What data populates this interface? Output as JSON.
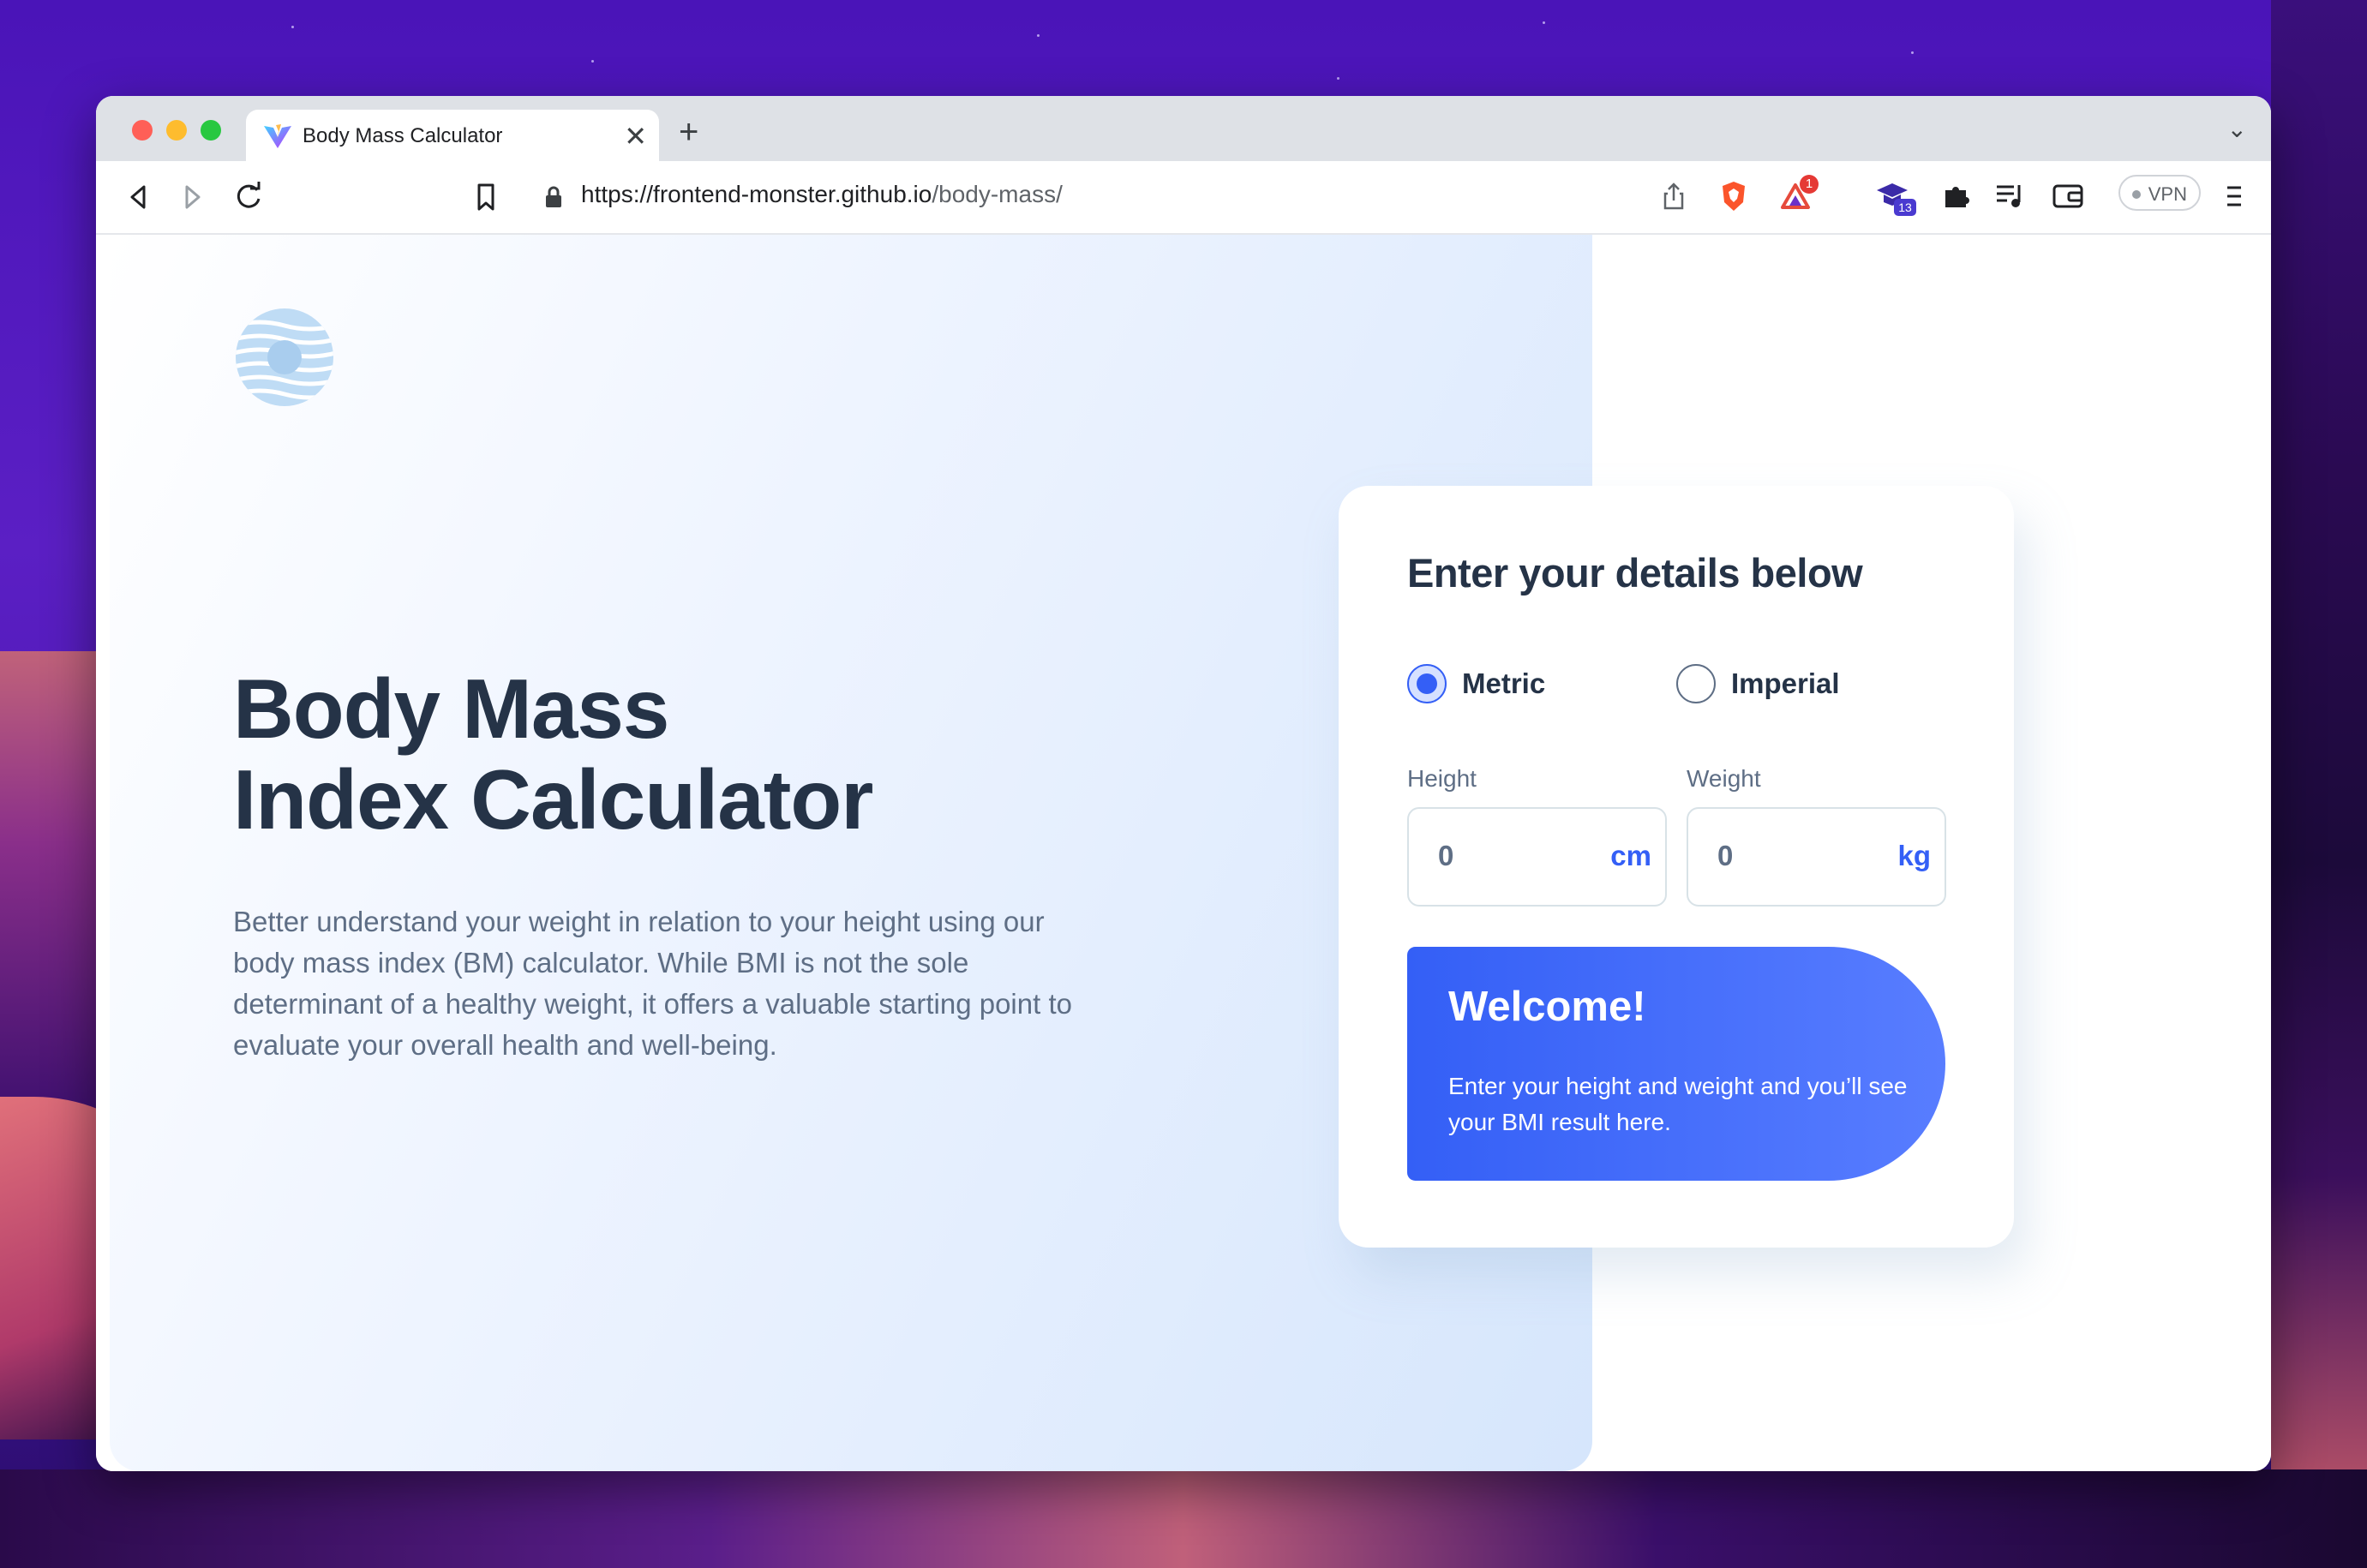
{
  "browser": {
    "tab_title": "Body Mass Calculator",
    "tab_close": "✕",
    "new_tab": "+",
    "tab_menu": "⌄",
    "url_host": "https://frontend-monster.github.io",
    "url_path": "/body-mass/",
    "vpn_label": "VPN",
    "extension_badge": "13",
    "rewards_badge": "1"
  },
  "page": {
    "headline_line1": "Body Mass",
    "headline_line2": "Index Calculator",
    "description": "Better understand your weight in relation to your height using our body mass index (BM) calculator. While BMI is not the sole determinant of a healthy weight, it offers a valuable starting point to evaluate your overall health and well-being."
  },
  "form": {
    "title": "Enter your details below",
    "units": [
      {
        "label": "Metric",
        "selected": true
      },
      {
        "label": "Imperial",
        "selected": false
      }
    ],
    "height": {
      "label": "Height",
      "value": "0",
      "unit": "cm"
    },
    "weight": {
      "label": "Weight",
      "value": "0",
      "unit": "kg"
    }
  },
  "result": {
    "title": "Welcome!",
    "text": "Enter your height and weight and you’ll see your BMI result here."
  },
  "colors": {
    "accent": "#345ff6",
    "heading": "#253347",
    "body_text": "#5e6e85"
  }
}
